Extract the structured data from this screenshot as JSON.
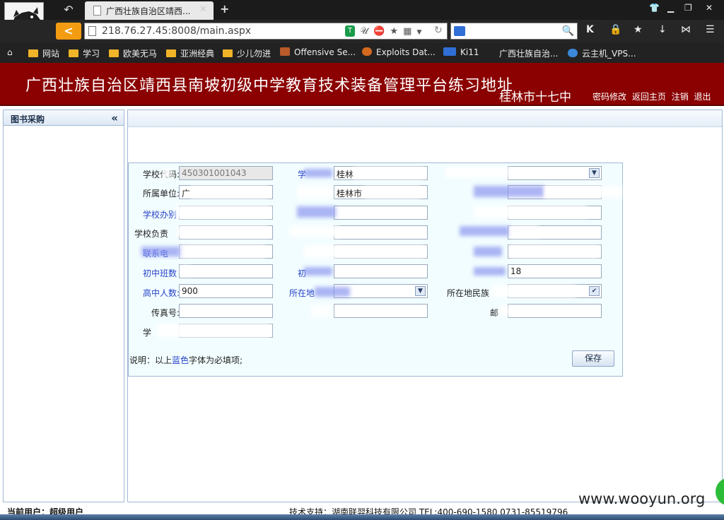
{
  "browser": {
    "tab_title": "广西壮族自治区靖西...",
    "url": "218.76.27.45:8008/main.aspx",
    "bookmarks": [
      {
        "label": "网站",
        "icon": "folder-icon"
      },
      {
        "label": "学习",
        "icon": "folder-icon"
      },
      {
        "label": "欧美无马",
        "icon": "folder-icon"
      },
      {
        "label": "亚洲经典",
        "icon": "folder-icon"
      },
      {
        "label": "少儿勿进",
        "icon": "folder-icon"
      },
      {
        "label": "Offensive Se...",
        "icon": "site-icon"
      },
      {
        "label": "Exploits Dat...",
        "icon": "site-icon"
      },
      {
        "label": "Ki11",
        "icon": "ct-icon"
      },
      {
        "label": "广西壮族自治...",
        "icon": "none"
      },
      {
        "label": "云主机_VPS...",
        "icon": "globe-icon"
      }
    ]
  },
  "header": {
    "title": "广西壮族自治区靖西县南坡初级中学教育技术装备管理平台练习地址",
    "school": "桂林市十七中",
    "links": [
      "密码修改",
      "返回主页",
      "注销",
      "退出"
    ]
  },
  "left_panel": {
    "title": "图书采购",
    "collapse_glyph": "«"
  },
  "form": {
    "school_code_label": "学校代码:",
    "school_code_value": "450301001043",
    "school_name_label": "学",
    "school_name_value": "桂林",
    "belong_unit_label": "所属单位:",
    "belong_unit_value": "广",
    "belong_unit_right_value": "桂林市",
    "school_type_label": "学校办别",
    "principal_label": "学校负责",
    "contact_label": "联系电",
    "junior_classes_label": "初中班数",
    "junior_students_label": "初",
    "junior_right_value": "18",
    "senior_students_label": "高中人数:",
    "senior_students_value": "900",
    "location_label": "所在地",
    "ethnic_region_label": "所在地民族",
    "fax_label": "传真号:",
    "postcode_label": "邮",
    "address_label": "学"
  },
  "note": {
    "prefix": "说明：以上",
    "highlight": "蓝色",
    "suffix": "字体为必填项;"
  },
  "buttons": {
    "save": "保存"
  },
  "footer": {
    "current_user": "当前用户：超级用户",
    "support": "技术支持：湖南联羿科技有限公司 TEL:400-690-1580 0731-85519796"
  },
  "watermark": "www.wooyun.org",
  "colors": {
    "header_bg": "#8b0000",
    "required_label": "#2743c9",
    "back_button": "#f39c12"
  }
}
